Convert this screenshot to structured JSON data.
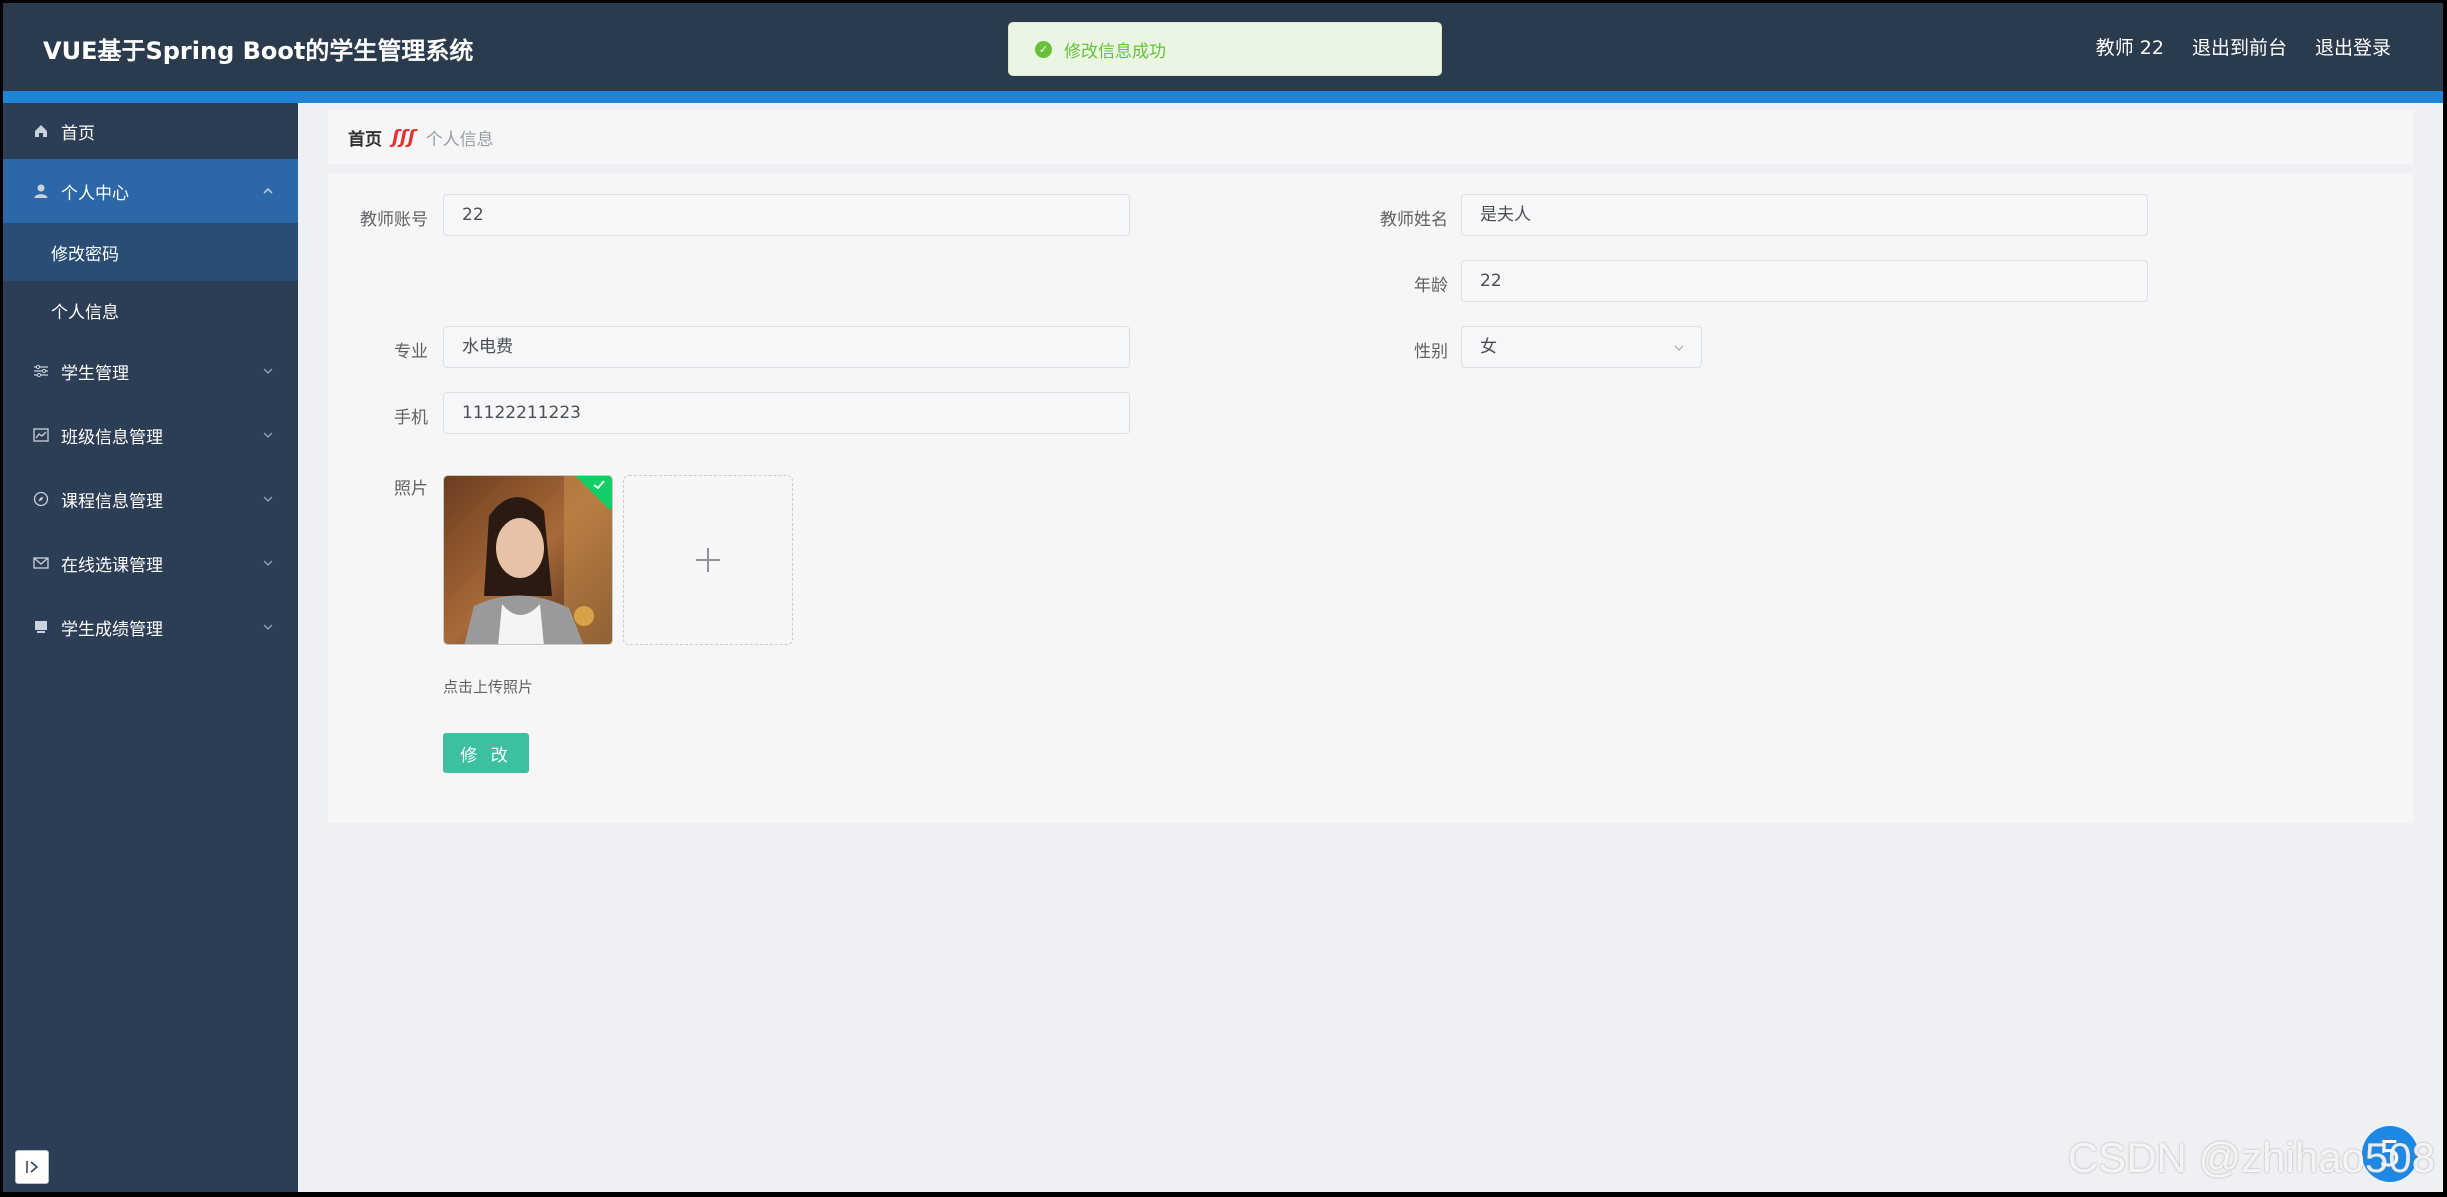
{
  "header": {
    "title": "VUE基于Spring Boot的学生管理系统",
    "user": "教师 22",
    "to_front": "退出到前台",
    "logout": "退出登录"
  },
  "toast": {
    "icon": "check-circle-icon",
    "message": "修改信息成功"
  },
  "sidebar": {
    "home": "首页",
    "personal_center": "个人中心",
    "sub_items": [
      "修改密码",
      "个人信息"
    ],
    "menus": [
      "学生管理",
      "班级信息管理",
      "课程信息管理",
      "在线选课管理",
      "学生成绩管理"
    ]
  },
  "breadcrumb": {
    "home": "首页",
    "separator": "ʃʃʃ",
    "current": "个人信息"
  },
  "form": {
    "account_label": "教师账号",
    "account_value": "22",
    "name_label": "教师姓名",
    "name_value": "是夫人",
    "age_label": "年龄",
    "age_value": "22",
    "major_label": "专业",
    "major_value": "水电费",
    "gender_label": "性别",
    "gender_value": "女",
    "phone_label": "手机",
    "phone_value": "11122211223",
    "photo_label": "照片",
    "upload_hint": "点击上传照片",
    "submit_label": "修 改"
  },
  "watermark": "CSDN @zhihao508",
  "scroll_top": "5",
  "colors": {
    "header": "#2b3b4e",
    "stripe": "#1f84d6",
    "sidebar": "#2c3e55",
    "primary_btn": "#3cc0a0",
    "success": "#67c23a"
  }
}
